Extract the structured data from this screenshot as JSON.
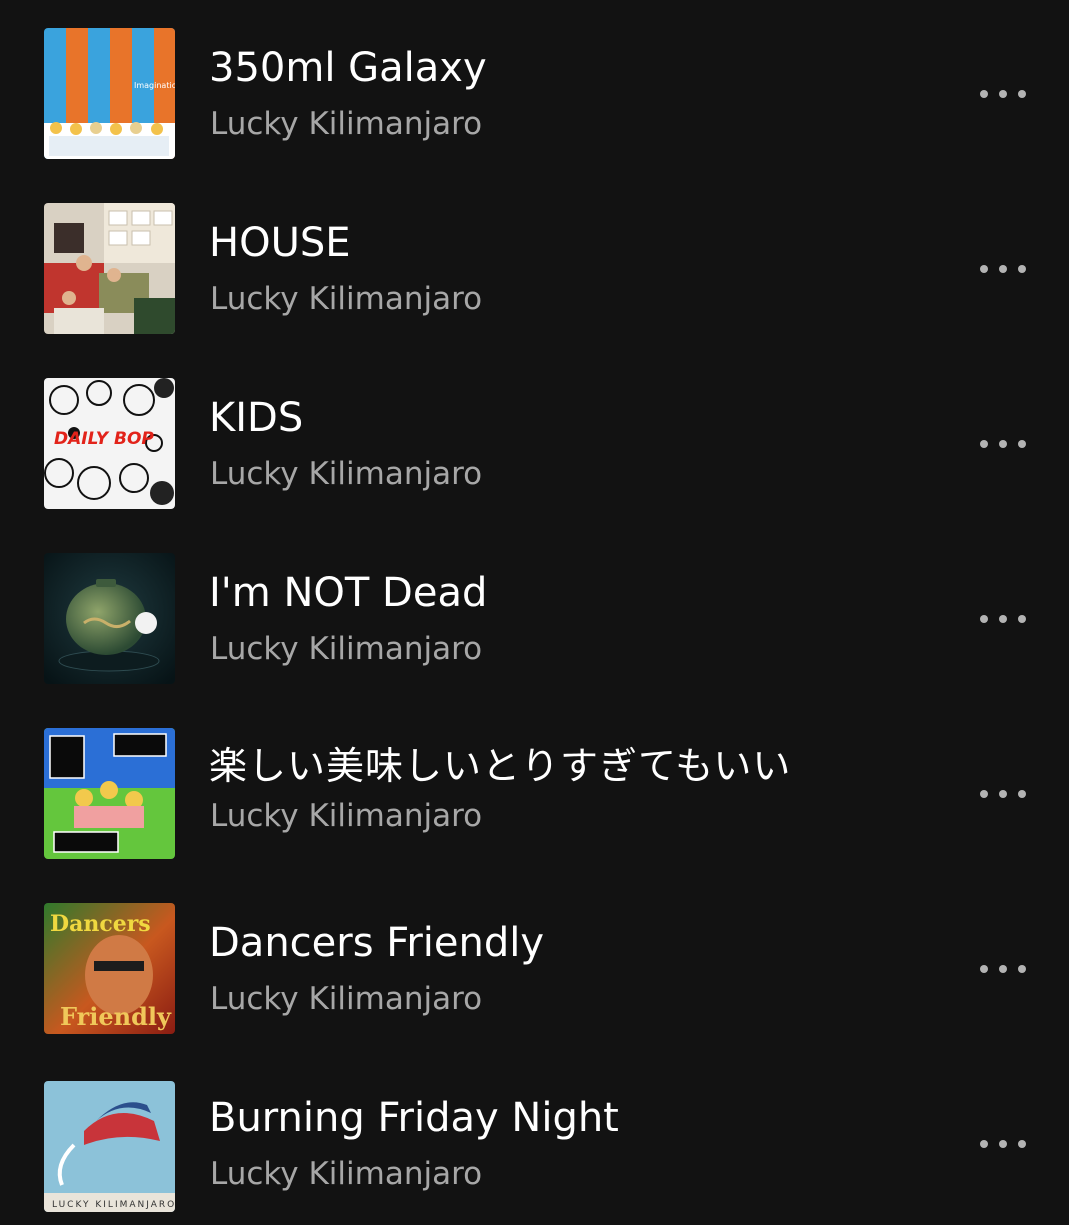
{
  "track_list": {
    "tracks": [
      {
        "title": "350ml Galaxy",
        "artist": "Lucky Kilimanjaro",
        "cover_text": "Imagination",
        "more_icon": "more-horizontal-icon"
      },
      {
        "title": "HOUSE",
        "artist": "Lucky Kilimanjaro",
        "more_icon": "more-horizontal-icon"
      },
      {
        "title": "KIDS",
        "artist": "Lucky Kilimanjaro",
        "cover_text": "DAILY BOP",
        "more_icon": "more-horizontal-icon"
      },
      {
        "title": "I'm NOT Dead",
        "artist": "Lucky Kilimanjaro",
        "more_icon": "more-horizontal-icon"
      },
      {
        "title": "楽しい美味しいとりすぎてもいい",
        "artist": "Lucky Kilimanjaro",
        "more_icon": "more-horizontal-icon"
      },
      {
        "title": "Dancers Friendly",
        "artist": "Lucky Kilimanjaro",
        "cover_text": "Dancers Friendly",
        "more_icon": "more-horizontal-icon"
      },
      {
        "title": "Burning Friday Night",
        "artist": "Lucky Kilimanjaro",
        "cover_text": "LUCKY KILIMANJARO",
        "more_icon": "more-horizontal-icon"
      }
    ]
  },
  "colors": {
    "background": "#121212",
    "title_text": "#ffffff",
    "artist_text": "#a7a7a7",
    "more_icon": "#b3b3b3"
  }
}
